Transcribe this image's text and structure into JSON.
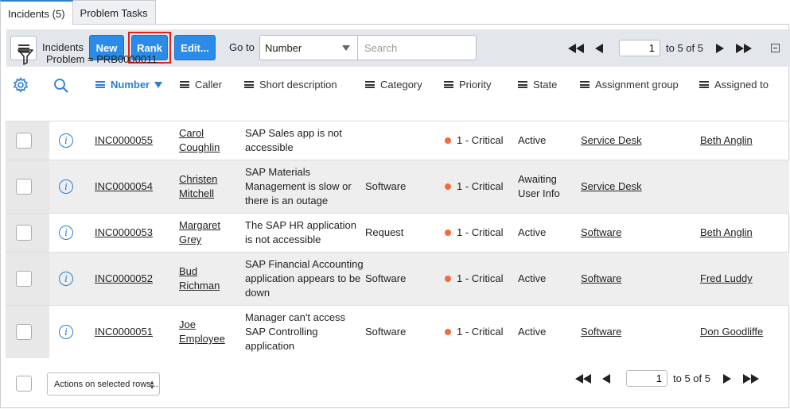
{
  "tabs": [
    {
      "label": "Incidents (5)",
      "active": true
    },
    {
      "label": "Problem Tasks",
      "active": false
    }
  ],
  "toolbar": {
    "title": "Incidents",
    "new_label": "New",
    "rank_label": "Rank",
    "edit_label": "Edit...",
    "goto_label": "Go to",
    "goto_field": "Number",
    "search_placeholder": "Search",
    "page": "1",
    "page_text": "to 5 of 5"
  },
  "filter": {
    "text": "Problem = PRB0000011"
  },
  "columns": {
    "number": "Number",
    "caller": "Caller",
    "short_description": "Short description",
    "category": "Category",
    "priority": "Priority",
    "state": "State",
    "assignment_group": "Assignment group",
    "assigned_to": "Assigned to"
  },
  "rows": [
    {
      "number": "INC0000055",
      "caller": [
        "Carol",
        "Coughlin"
      ],
      "short_description": [
        "SAP Sales app is not",
        "accessible"
      ],
      "category": "",
      "priority": "1 - Critical",
      "state": [
        "Active"
      ],
      "assignment_group": "Service Desk",
      "assigned_to": "Beth Anglin"
    },
    {
      "number": "INC0000054",
      "caller": [
        "Christen",
        "Mitchell"
      ],
      "short_description": [
        "SAP Materials",
        "Management is slow or",
        "there is an outage"
      ],
      "category": "Software",
      "priority": "1 - Critical",
      "state": [
        "Awaiting",
        "User Info"
      ],
      "assignment_group": "Service Desk",
      "assigned_to": ""
    },
    {
      "number": "INC0000053",
      "caller": [
        "Margaret",
        "Grey"
      ],
      "short_description": [
        "The SAP HR application",
        "is not accessible"
      ],
      "category": "Request",
      "priority": "1 - Critical",
      "state": [
        "Active"
      ],
      "assignment_group": "Software",
      "assigned_to": "Beth Anglin"
    },
    {
      "number": "INC0000052",
      "caller": [
        "Bud",
        "Richman"
      ],
      "short_description": [
        "SAP Financial Accounting",
        "application appears to be",
        "down"
      ],
      "category": "Software",
      "priority": "1 - Critical",
      "state": [
        "Active"
      ],
      "assignment_group": "Software",
      "assigned_to": "Fred Luddy"
    },
    {
      "number": "INC0000051",
      "caller": [
        "Joe",
        "Employee"
      ],
      "short_description": [
        "Manager can't access",
        "SAP Controlling",
        "application"
      ],
      "category": "Software",
      "priority": "1 - Critical",
      "state": [
        "Active"
      ],
      "assignment_group": "Software",
      "assigned_to": "Don Goodliffe"
    }
  ],
  "footer": {
    "actions_label": "Actions on selected rows...",
    "page": "1",
    "page_text": "to 5 of 5"
  },
  "colors": {
    "primary": "#2b8be8",
    "link_blue": "#2b7ecf",
    "critical": "#f26b3a",
    "highlight": "#e0201a"
  }
}
